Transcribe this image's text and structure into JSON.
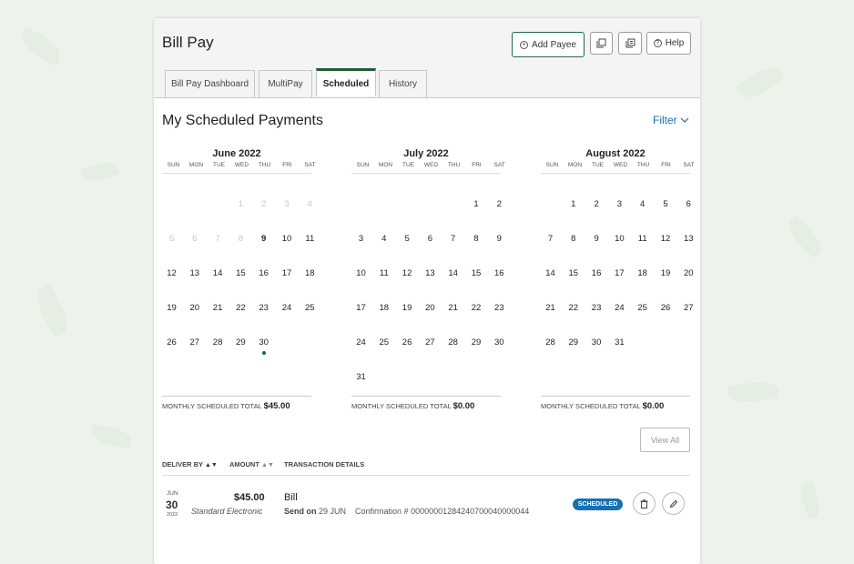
{
  "page_title": "Bill Pay",
  "header_buttons": {
    "add_payee": "Add Payee",
    "help": "Help"
  },
  "tabs": [
    {
      "label": "Bill Pay Dashboard",
      "active": false
    },
    {
      "label": "MultiPay",
      "active": false
    },
    {
      "label": "Scheduled",
      "active": true
    },
    {
      "label": "History",
      "active": false
    }
  ],
  "section_title": "My Scheduled Payments",
  "filter_label": "Filter",
  "weekdays": [
    "SUN",
    "MON",
    "TUE",
    "WED",
    "THU",
    "FRI",
    "SAT"
  ],
  "months": [
    {
      "title": "June 2022",
      "weeks": [
        [
          "",
          "",
          "",
          "1",
          "2",
          "3",
          "4"
        ],
        [
          "5",
          "6",
          "7",
          "8",
          "9",
          "10",
          "11"
        ],
        [
          "12",
          "13",
          "14",
          "15",
          "16",
          "17",
          "18"
        ],
        [
          "19",
          "20",
          "21",
          "22",
          "23",
          "24",
          "25"
        ],
        [
          "26",
          "27",
          "28",
          "29",
          "30",
          "",
          ""
        ]
      ],
      "muted_through": "8",
      "highlight_day": "9",
      "scheduled_days": [
        "30"
      ],
      "total_label": "MONTHLY SCHEDULED TOTAL",
      "total_value": "$45.00"
    },
    {
      "title": "July 2022",
      "weeks": [
        [
          "",
          "",
          "",
          "",
          "",
          "1",
          "2"
        ],
        [
          "3",
          "4",
          "5",
          "6",
          "7",
          "8",
          "9"
        ],
        [
          "10",
          "11",
          "12",
          "13",
          "14",
          "15",
          "16"
        ],
        [
          "17",
          "18",
          "19",
          "20",
          "21",
          "22",
          "23"
        ],
        [
          "24",
          "25",
          "26",
          "27",
          "28",
          "29",
          "30"
        ],
        [
          "31",
          "",
          "",
          "",
          "",
          "",
          ""
        ]
      ],
      "total_label": "MONTHLY SCHEDULED TOTAL",
      "total_value": "$0.00"
    },
    {
      "title": "August 2022",
      "weeks": [
        [
          "",
          "1",
          "2",
          "3",
          "4",
          "5",
          "6"
        ],
        [
          "7",
          "8",
          "9",
          "10",
          "11",
          "12",
          "13"
        ],
        [
          "14",
          "15",
          "16",
          "17",
          "18",
          "19",
          "20"
        ],
        [
          "21",
          "22",
          "23",
          "24",
          "25",
          "26",
          "27"
        ],
        [
          "28",
          "29",
          "30",
          "31",
          "",
          "",
          ""
        ]
      ],
      "total_label": "MONTHLY SCHEDULED TOTAL",
      "total_value": "$0.00"
    }
  ],
  "view_all_label": "View All",
  "table_headers": {
    "deliver_by": "DELIVER BY",
    "amount": "AMOUNT",
    "details": "TRANSACTION DETAILS"
  },
  "payment": {
    "month": "JUN",
    "day": "30",
    "year": "2022",
    "amount": "$45.00",
    "method": "Standard Electronic",
    "payee": "Bill",
    "send_on_label": "Send on",
    "send_on_date": "29 JUN",
    "confirmation_label": "Confirmation #",
    "confirmation": "00000001284240700040000044",
    "status": "SCHEDULED"
  },
  "colors": {
    "primary_green": "#1f6b43",
    "link_blue": "#1a6fb0",
    "badge_blue": "#1a6fb0"
  }
}
